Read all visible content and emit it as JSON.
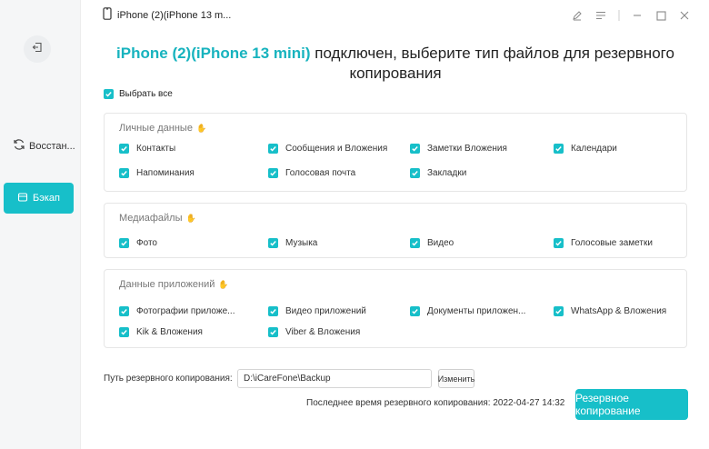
{
  "window": {
    "title": "iPhone (2)(iPhone 13 m..."
  },
  "sidebar": {
    "items": [
      {
        "label": "Восстан...",
        "icon": "restore-icon",
        "active": false
      },
      {
        "label": "Бэкап",
        "icon": "backup-icon",
        "active": true
      }
    ]
  },
  "heading": {
    "device": "iPhone (2)(iPhone 13 mini)",
    "line1_rest": " подключен, выберите тип файлов для резервного",
    "line2": "копирования"
  },
  "select_all": {
    "label": "Выбрать все",
    "checked": true
  },
  "sections": [
    {
      "title": "Личные данные",
      "items": [
        "Контакты",
        "Сообщения и Вложения",
        "Заметки Вложения",
        "Календари",
        "Напоминания",
        "Голосовая почта",
        "Закладки"
      ]
    },
    {
      "title": "Медиафайлы",
      "items": [
        "Фото",
        "Музыка",
        "Видео",
        "Голосовые заметки"
      ]
    },
    {
      "title": "Данные приложений",
      "items": [
        "Фотографии приложе...",
        "Видео приложений",
        "Документы приложен...",
        "WhatsApp & Вложения",
        "Kik & Вложения",
        "Viber & Вложения"
      ]
    }
  ],
  "backup_path": {
    "label": "Путь резервного копирования:",
    "value": "D:\\iCareFone\\Backup",
    "change_label": "Изменить"
  },
  "last_backup": "Последнее время резервного копирования: 2022-04-27 14:32",
  "backup_button": "Резервное копирование",
  "colors": {
    "accent": "#17bfc9",
    "device_name": "#17b3be"
  }
}
